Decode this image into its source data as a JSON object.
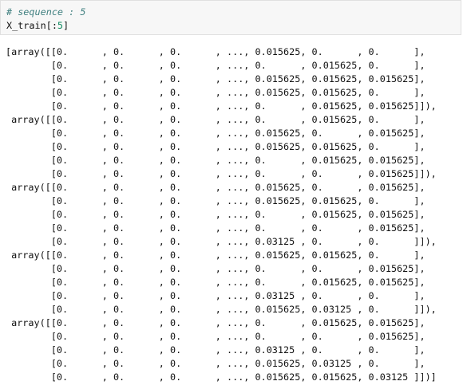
{
  "input_cell": {
    "comment": "# sequence : 5",
    "code_prefix": "X_train[:",
    "code_number": "5",
    "code_suffix": "]"
  },
  "output": {
    "lines": [
      "[array([[0.      , 0.      , 0.      , ..., 0.015625, 0.      , 0.      ],",
      "        [0.      , 0.      , 0.      , ..., 0.      , 0.015625, 0.      ],",
      "        [0.      , 0.      , 0.      , ..., 0.015625, 0.015625, 0.015625],",
      "        [0.      , 0.      , 0.      , ..., 0.015625, 0.015625, 0.      ],",
      "        [0.      , 0.      , 0.      , ..., 0.      , 0.015625, 0.015625]]),",
      " array([[0.      , 0.      , 0.      , ..., 0.      , 0.015625, 0.      ],",
      "        [0.      , 0.      , 0.      , ..., 0.015625, 0.      , 0.015625],",
      "        [0.      , 0.      , 0.      , ..., 0.015625, 0.015625, 0.      ],",
      "        [0.      , 0.      , 0.      , ..., 0.      , 0.015625, 0.015625],",
      "        [0.      , 0.      , 0.      , ..., 0.      , 0.      , 0.015625]]),",
      " array([[0.      , 0.      , 0.      , ..., 0.015625, 0.      , 0.015625],",
      "        [0.      , 0.      , 0.      , ..., 0.015625, 0.015625, 0.      ],",
      "        [0.      , 0.      , 0.      , ..., 0.      , 0.015625, 0.015625],",
      "        [0.      , 0.      , 0.      , ..., 0.      , 0.      , 0.015625],",
      "        [0.      , 0.      , 0.      , ..., 0.03125 , 0.      , 0.      ]]),",
      " array([[0.      , 0.      , 0.      , ..., 0.015625, 0.015625, 0.      ],",
      "        [0.      , 0.      , 0.      , ..., 0.      , 0.      , 0.015625],",
      "        [0.      , 0.      , 0.      , ..., 0.      , 0.015625, 0.015625],",
      "        [0.      , 0.      , 0.      , ..., 0.03125 , 0.      , 0.      ],",
      "        [0.      , 0.      , 0.      , ..., 0.015625, 0.03125 , 0.      ]]),",
      " array([[0.      , 0.      , 0.      , ..., 0.      , 0.015625, 0.015625],",
      "        [0.      , 0.      , 0.      , ..., 0.      , 0.      , 0.015625],",
      "        [0.      , 0.      , 0.      , ..., 0.03125 , 0.      , 0.      ],",
      "        [0.      , 0.      , 0.      , ..., 0.015625, 0.03125 , 0.      ],",
      "        [0.      , 0.      , 0.      , ..., 0.015625, 0.015625, 0.03125 ]])]"
    ]
  }
}
